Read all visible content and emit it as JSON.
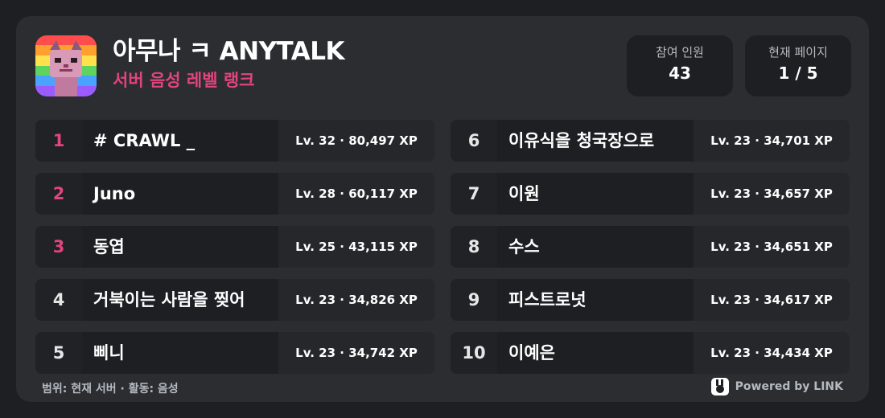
{
  "header": {
    "title": "아무나 ㅋ ANYTALK",
    "subtitle": "서버 음성 레벨 랭크",
    "avatar_icon": "pixel-cat-rainbow-avatar"
  },
  "stats": {
    "participants_label": "참여 인원",
    "participants_value": "43",
    "page_label": "현재 페이지",
    "page_value": "1 / 5"
  },
  "leaderboard": {
    "left": [
      {
        "rank": "1",
        "name": "# CRAWL _",
        "xp": "Lv. 32 · 80,497 XP"
      },
      {
        "rank": "2",
        "name": "Juno",
        "xp": "Lv. 28 · 60,117 XP"
      },
      {
        "rank": "3",
        "name": "동엽",
        "xp": "Lv. 25 · 43,115 XP"
      },
      {
        "rank": "4",
        "name": "거북이는 사람을 찢어",
        "xp": "Lv. 23 · 34,826 XP"
      },
      {
        "rank": "5",
        "name": "삐니",
        "xp": "Lv. 23 · 34,742 XP"
      }
    ],
    "right": [
      {
        "rank": "6",
        "name": "이유식을 청국장으로",
        "xp": "Lv. 23 · 34,701 XP"
      },
      {
        "rank": "7",
        "name": "이원",
        "xp": "Lv. 23 · 34,657 XP"
      },
      {
        "rank": "8",
        "name": "수스",
        "xp": "Lv. 23 · 34,651 XP"
      },
      {
        "rank": "9",
        "name": "피스트로넛",
        "xp": "Lv. 23 · 34,617 XP"
      },
      {
        "rank": "10",
        "name": "이예은",
        "xp": "Lv. 23 · 34,434 XP"
      }
    ]
  },
  "footer": {
    "scope": "범위: 현재 서버 · 활동: 음성",
    "powered": "Powered by LINK",
    "powered_icon": "link-bunny-icon"
  },
  "colors": {
    "background": "#1e1f22",
    "card": "#2b2d31",
    "accent": "#e0457b",
    "text": "#ffffff",
    "muted": "#b5bac1"
  }
}
